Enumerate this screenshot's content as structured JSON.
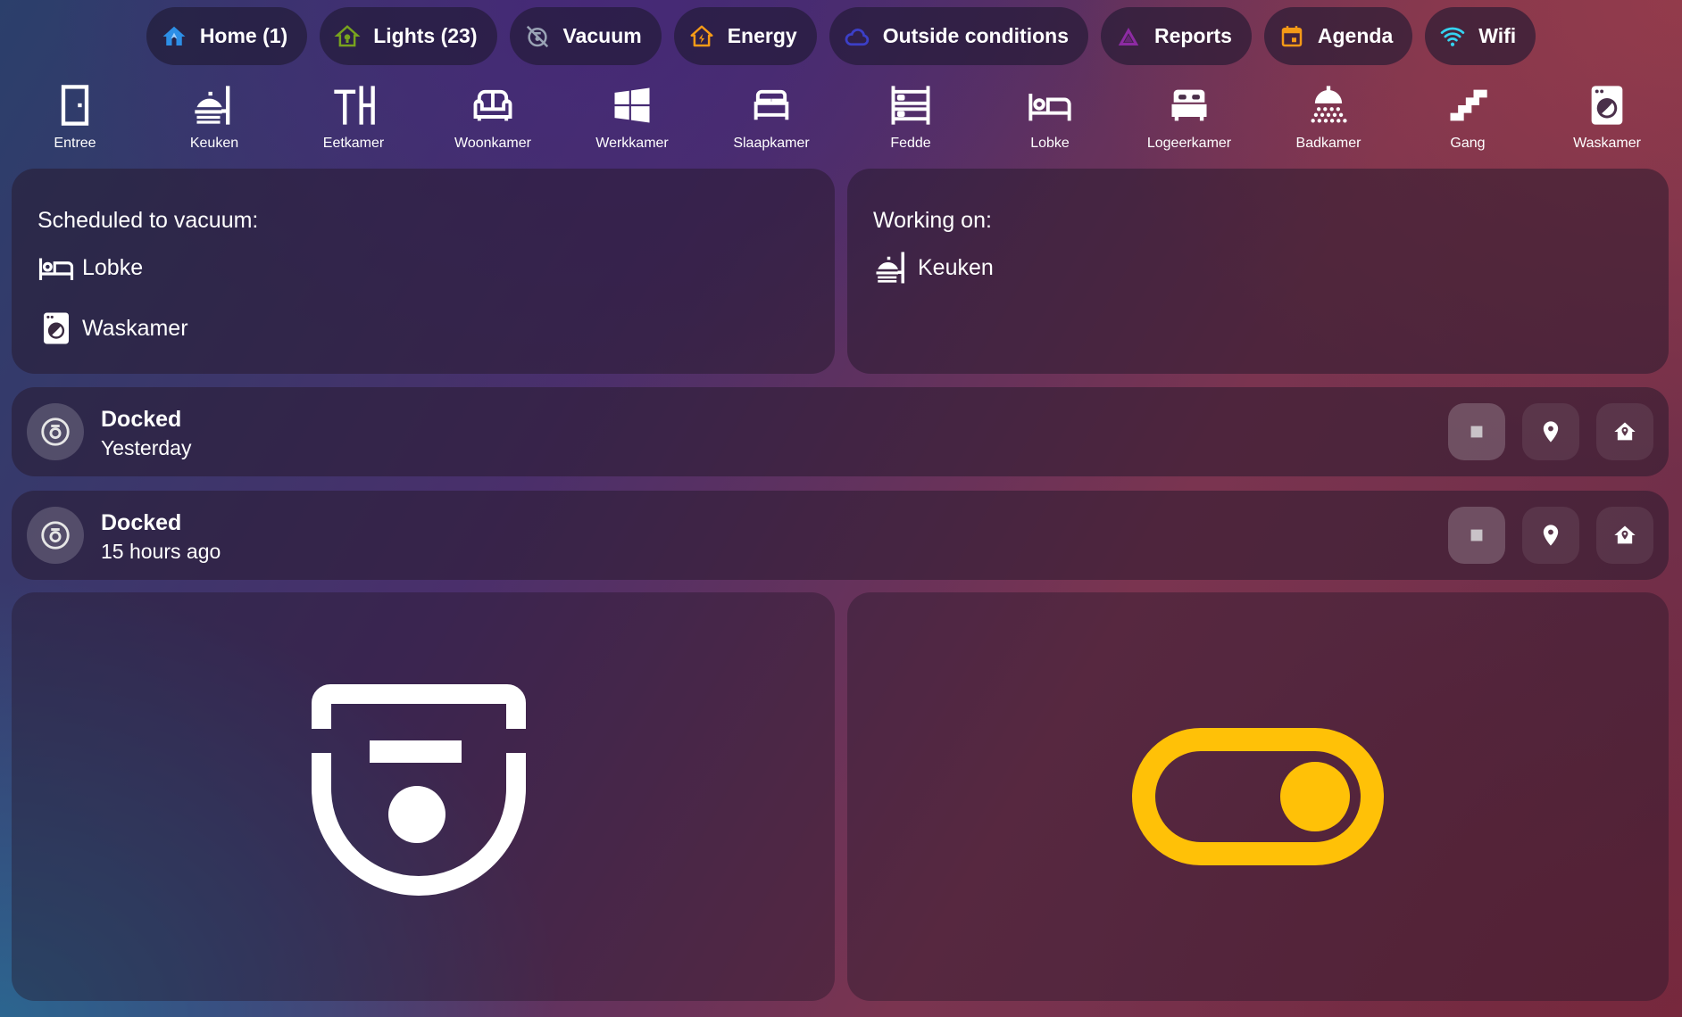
{
  "colors": {
    "home": "#2d8fe6",
    "lights": "#78a31e",
    "vacuum_chip": "#9aa3b5",
    "energy": "#f59a17",
    "outside": "#3c3fc7",
    "reports": "#8d2ba3",
    "agenda": "#f59a17",
    "wifi": "#35d3f0",
    "toggle": "#ffc107"
  },
  "chips": [
    {
      "label": "Home (1)",
      "icon": "home-icon"
    },
    {
      "label": "Lights (23)",
      "icon": "lightbulb-home-icon"
    },
    {
      "label": "Vacuum",
      "icon": "vacuum-off-icon"
    },
    {
      "label": "Energy",
      "icon": "home-lightning-icon"
    },
    {
      "label": "Outside conditions",
      "icon": "cloud-icon"
    },
    {
      "label": "Reports",
      "icon": "chart-triangle-icon"
    },
    {
      "label": "Agenda",
      "icon": "calendar-icon"
    },
    {
      "label": "Wifi",
      "icon": "wifi-icon"
    }
  ],
  "rooms": [
    {
      "label": "Entree",
      "icon": "door-icon"
    },
    {
      "label": "Keuken",
      "icon": "stove-icon"
    },
    {
      "label": "Eetkamer",
      "icon": "table-chair-icon"
    },
    {
      "label": "Woonkamer",
      "icon": "sofa-icon"
    },
    {
      "label": "Werkkamer",
      "icon": "windows-icon"
    },
    {
      "label": "Slaapkamer",
      "icon": "bed-double-icon"
    },
    {
      "label": "Fedde",
      "icon": "bunk-bed-icon"
    },
    {
      "label": "Lobke",
      "icon": "bed-icon"
    },
    {
      "label": "Logeerkamer",
      "icon": "bed-empty-icon"
    },
    {
      "label": "Badkamer",
      "icon": "shower-icon"
    },
    {
      "label": "Gang",
      "icon": "stairs-icon"
    },
    {
      "label": "Waskamer",
      "icon": "washing-machine-icon"
    }
  ],
  "scheduled": {
    "title": "Scheduled to vacuum:",
    "items": [
      {
        "label": "Lobke",
        "icon": "bed-icon"
      },
      {
        "label": "Waskamer",
        "icon": "washing-machine-icon"
      }
    ]
  },
  "working": {
    "title": "Working on:",
    "items": [
      {
        "label": "Keuken",
        "icon": "stove-icon"
      }
    ]
  },
  "vacuums": [
    {
      "state": "Docked",
      "time": "Yesterday"
    },
    {
      "state": "Docked",
      "time": "15 hours ago"
    }
  ],
  "toggle": {
    "state": "on"
  }
}
